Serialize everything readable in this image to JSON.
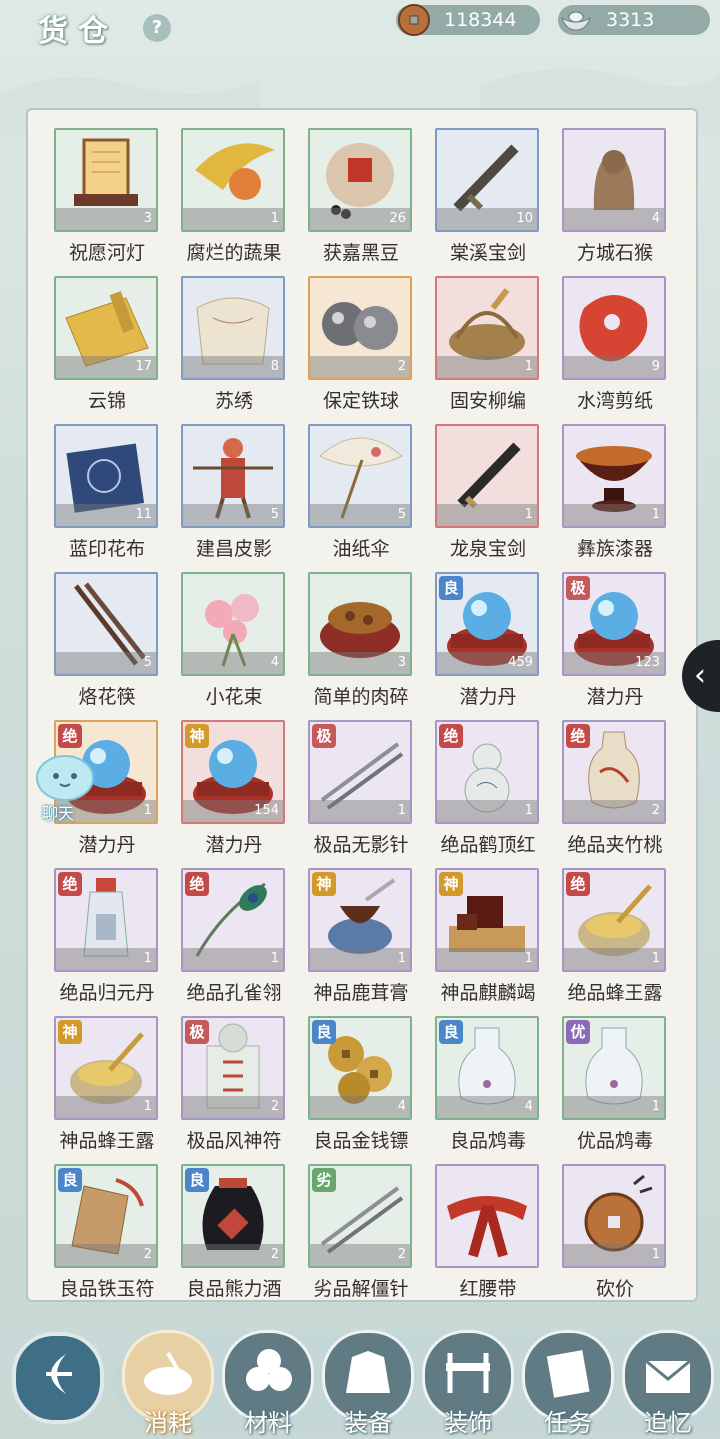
{
  "header": {
    "title": "货仓",
    "help": "?",
    "copper": "118344",
    "silver": "3313"
  },
  "items": [
    {
      "name": "祝愿河灯",
      "count": "3",
      "frame": "green",
      "grade": "",
      "icon": "lantern"
    },
    {
      "name": "腐烂的蔬果",
      "count": "1",
      "frame": "green",
      "grade": "",
      "icon": "fruit"
    },
    {
      "name": "获嘉黑豆",
      "count": "26",
      "frame": "green",
      "grade": "",
      "icon": "jar"
    },
    {
      "name": "棠溪宝剑",
      "count": "10",
      "frame": "blue",
      "grade": "",
      "icon": "sword"
    },
    {
      "name": "方城石猴",
      "count": "4",
      "frame": "purple",
      "grade": "",
      "icon": "statue"
    },
    {
      "name": "云锦",
      "count": "17",
      "frame": "green",
      "grade": "",
      "icon": "scroll"
    },
    {
      "name": "苏绣",
      "count": "8",
      "frame": "blue",
      "grade": "",
      "icon": "cloth"
    },
    {
      "name": "保定铁球",
      "count": "2",
      "frame": "orange",
      "grade": "",
      "icon": "balls"
    },
    {
      "name": "固安柳编",
      "count": "1",
      "frame": "red",
      "grade": "",
      "icon": "basket"
    },
    {
      "name": "水湾剪纸",
      "count": "9",
      "frame": "purple",
      "grade": "",
      "icon": "papercut"
    },
    {
      "name": "蓝印花布",
      "count": "11",
      "frame": "blue",
      "grade": "",
      "icon": "bluecloth"
    },
    {
      "name": "建昌皮影",
      "count": "5",
      "frame": "blue",
      "grade": "",
      "icon": "puppet"
    },
    {
      "name": "油纸伞",
      "count": "5",
      "frame": "blue",
      "grade": "",
      "icon": "umbrella"
    },
    {
      "name": "龙泉宝剑",
      "count": "1",
      "frame": "red",
      "grade": "",
      "icon": "sword2"
    },
    {
      "name": "彝族漆器",
      "count": "1",
      "frame": "purple",
      "grade": "",
      "icon": "bowl"
    },
    {
      "name": "烙花筷",
      "count": "5",
      "frame": "blue",
      "grade": "",
      "icon": "chopsticks"
    },
    {
      "name": "小花束",
      "count": "4",
      "frame": "green",
      "grade": "",
      "icon": "flowers"
    },
    {
      "name": "简单的肉碎",
      "count": "3",
      "frame": "green",
      "grade": "",
      "icon": "meat"
    },
    {
      "name": "潜力丹",
      "count": "459",
      "frame": "blue",
      "grade": "良",
      "gradeClass": "g-liang",
      "icon": "orb"
    },
    {
      "name": "潜力丹",
      "count": "123",
      "frame": "purple",
      "grade": "极",
      "gradeClass": "g-ji",
      "icon": "orb"
    },
    {
      "name": "潜力丹",
      "count": "1",
      "frame": "orange",
      "grade": "绝",
      "gradeClass": "g-jue",
      "icon": "orb"
    },
    {
      "name": "潜力丹",
      "count": "154",
      "frame": "red",
      "grade": "神",
      "gradeClass": "g-shen",
      "icon": "orb"
    },
    {
      "name": "极品无影针",
      "count": "1",
      "frame": "purple",
      "grade": "极",
      "gradeClass": "g-ji",
      "icon": "needles"
    },
    {
      "name": "绝品鹤顶红",
      "count": "1",
      "frame": "purple",
      "grade": "绝",
      "gradeClass": "g-jue",
      "icon": "gourd"
    },
    {
      "name": "绝品夹竹桃",
      "count": "2",
      "frame": "purple",
      "grade": "绝",
      "gradeClass": "g-jue",
      "icon": "vase"
    },
    {
      "name": "绝品归元丹",
      "count": "1",
      "frame": "purple",
      "grade": "绝",
      "gradeClass": "g-jue",
      "icon": "bottle"
    },
    {
      "name": "绝品孔雀翎",
      "count": "1",
      "frame": "purple",
      "grade": "绝",
      "gradeClass": "g-jue",
      "icon": "feather"
    },
    {
      "name": "神品鹿茸膏",
      "count": "1",
      "frame": "purple",
      "grade": "神",
      "gradeClass": "g-shen",
      "icon": "paste"
    },
    {
      "name": "神品麒麟竭",
      "count": "1",
      "frame": "purple",
      "grade": "神",
      "gradeClass": "g-shen",
      "icon": "resin"
    },
    {
      "name": "绝品蜂王露",
      "count": "1",
      "frame": "purple",
      "grade": "绝",
      "gradeClass": "g-jue",
      "icon": "honey"
    },
    {
      "name": "神品蜂王露",
      "count": "1",
      "frame": "purple",
      "grade": "神",
      "gradeClass": "g-shen",
      "icon": "honey"
    },
    {
      "name": "极品风神符",
      "count": "2",
      "frame": "purple",
      "grade": "极",
      "gradeClass": "g-ji",
      "icon": "talisman"
    },
    {
      "name": "良品金钱镖",
      "count": "4",
      "frame": "green",
      "grade": "良",
      "gradeClass": "g-liang",
      "icon": "coins"
    },
    {
      "name": "良品鸩毒",
      "count": "4",
      "frame": "green",
      "grade": "良",
      "gradeClass": "g-liang",
      "icon": "flask"
    },
    {
      "name": "优品鸩毒",
      "count": "1",
      "frame": "green",
      "grade": "优",
      "gradeClass": "g-you",
      "icon": "flask"
    },
    {
      "name": "良品铁玉符",
      "count": "2",
      "frame": "green",
      "grade": "良",
      "gradeClass": "g-liang",
      "icon": "ironcharm"
    },
    {
      "name": "良品熊力酒",
      "count": "2",
      "frame": "green",
      "grade": "良",
      "gradeClass": "g-liang",
      "icon": "winejar"
    },
    {
      "name": "劣品解僵针",
      "count": "2",
      "frame": "green",
      "grade": "劣",
      "gradeClass": "g-lie",
      "icon": "needles"
    },
    {
      "name": "红腰带",
      "count": "",
      "frame": "purple",
      "grade": "",
      "icon": "belt"
    },
    {
      "name": "砍价",
      "count": "1",
      "frame": "purple",
      "grade": "",
      "icon": "bargain"
    }
  ],
  "chat": {
    "label": "聊天"
  },
  "tabs": [
    {
      "label": "消耗",
      "icon": "bowl-icon",
      "active": true
    },
    {
      "label": "材料",
      "icon": "logs-icon",
      "active": false
    },
    {
      "label": "装备",
      "icon": "robe-icon",
      "active": false
    },
    {
      "label": "装饰",
      "icon": "bench-icon",
      "active": false
    },
    {
      "label": "任务",
      "icon": "book-icon",
      "active": false
    },
    {
      "label": "追忆",
      "icon": "letter-icon",
      "active": false
    }
  ],
  "colors": {
    "accent": "#e7d1a4",
    "tab": "#617b84",
    "panel": "#f4f2ec"
  }
}
